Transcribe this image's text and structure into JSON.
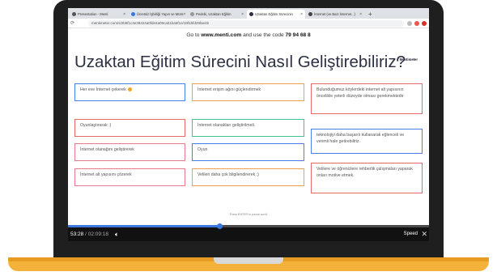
{
  "browser": {
    "tabs": [
      {
        "title": "Presentation - Menti",
        "active": false
      },
      {
        "title": "Ücretsiz İşbirliği Yapın ve Mürü",
        "active": false
      },
      {
        "title": "Pedebi, Uzaktan Eğitim",
        "active": false
      },
      {
        "title": "Uzaktan Eğitim Sürecinin",
        "active": true
      },
      {
        "title": "İnternet (ve Bazı İnternet...)",
        "active": false
      }
    ],
    "new_tab": "+",
    "url": "mentimeter.com/s/2b5f1c3e38424a0fde2a09cab1ba6f1e/18f1bfd29fae4b"
  },
  "slide": {
    "goto_prefix": "Go to ",
    "goto_site": "www.menti.com",
    "goto_mid": " and use the code ",
    "goto_code": "79 94 68 8",
    "brand": "Mentimeter",
    "title": "Uzaktan Eğitim Sürecini Nasıl Geliştirebiliriz?",
    "press_hint": "Press ENTER to pause scroll",
    "answers": [
      {
        "text": "Her eve İnternet çekerek",
        "color": "blue",
        "emoji": true
      },
      {
        "text": "İnternet erişim ağını güçlendirmek",
        "color": "orange"
      },
      {
        "text": "Bulunduğumuz köylerdeki internet alt yapısının öncelikle yeterli düzeyde olması gerekmektedir",
        "color": "red"
      },
      {
        "text": "Oyunlaştırarak :)",
        "color": "red"
      },
      {
        "text": "İnternet olanakları geliştirilmeli.",
        "color": "green"
      },
      {
        "text": "teknolojiyi daha başarılı kullanarak eğlenceli ve verimli hale getirebiliriz.",
        "color": "blue"
      },
      {
        "text": "İnternet olanağını geliştirerek",
        "color": "pink"
      },
      {
        "text": "Oyun",
        "color": "blue"
      },
      {
        "text": "İnternet alt yapısını çözerek",
        "color": "pink"
      },
      {
        "text": "Velileri daha çok bilgilendirerek :)",
        "color": "orange"
      },
      {
        "text": "Velilere ve öğrencilere rehberlik çalışmaları yaparak onları motive etmek.",
        "color": "red"
      }
    ]
  },
  "player": {
    "current_time": "53:28",
    "duration": "02:09:18",
    "progress": 0.42,
    "speed_label": "Speed",
    "volume_icon": "speaker-icon",
    "close_icon": "close-icon"
  },
  "colors": {
    "laptop_body": "#1f1f1f",
    "laptop_base": "#f5b23a",
    "accent_blue": "#3a78e0"
  }
}
